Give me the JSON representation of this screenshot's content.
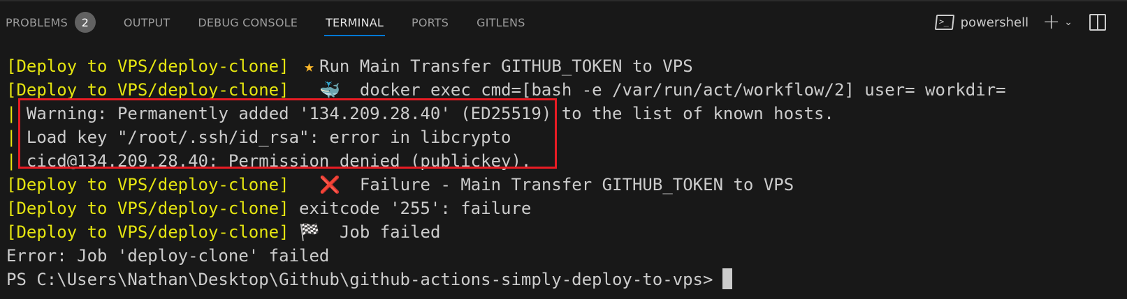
{
  "tabs": [
    {
      "label": "PROBLEMS",
      "badge": "2"
    },
    {
      "label": "OUTPUT"
    },
    {
      "label": "DEBUG CONSOLE"
    },
    {
      "label": "TERMINAL",
      "active": true
    },
    {
      "label": "PORTS"
    },
    {
      "label": "GITLENS"
    }
  ],
  "actions": {
    "shell_label": "powershell",
    "shell_icon": "terminal-powershell-icon",
    "new_icon": "plus-icon",
    "dropdown_icon": "chevron-down-icon",
    "split_icon": "split-panel-icon"
  },
  "colors": {
    "job_prefix": "#e5e510",
    "highlight_box": "#e81c24",
    "active_tab_underline": "#0078d4"
  },
  "terminal": {
    "prefix": "[Deploy to VPS/deploy-clone]",
    "pipe": "|",
    "lines": [
      {
        "icon": "★",
        "text": "Run Main Transfer GITHUB_TOKEN to VPS"
      },
      {
        "icon": "🐳",
        "text": "docker exec cmd=[bash -e /var/run/act/workflow/2] user= workdir="
      },
      {
        "text": "Warning: Permanently added '134.209.28.40' (ED25519) to the list of known hosts."
      },
      {
        "text": "Load key \"/root/.ssh/id_rsa\": error in libcrypto"
      },
      {
        "text": "cicd@134.209.28.40: Permission denied (publickey)."
      },
      {
        "icon": "❌",
        "text": "Failure - Main Transfer GITHUB_TOKEN to VPS"
      },
      {
        "text": "exitcode '255': failure"
      },
      {
        "icon": "🏁",
        "text": "Job failed"
      },
      {
        "text": "Error: Job 'deploy-clone' failed"
      },
      {
        "text": "PS C:\\Users\\Nathan\\Desktop\\Github\\github-actions-simply-deploy-to-vps>"
      }
    ]
  }
}
